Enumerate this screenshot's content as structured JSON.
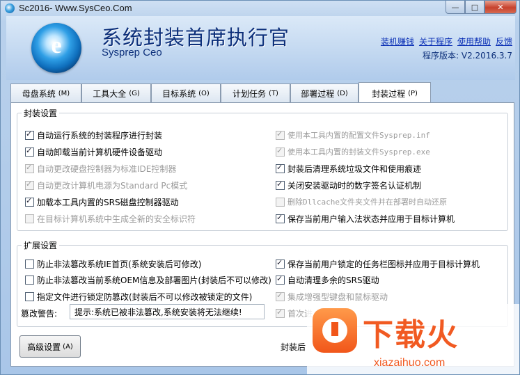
{
  "window": {
    "title": "Sc2016- Www.SysCeo.Com",
    "controls": {
      "minimize": "—",
      "maximize": "□",
      "close": "✕"
    }
  },
  "header": {
    "app_name": "系统封装首席执行官",
    "app_subtitle": "Sysprep  Ceo",
    "links": [
      "装机赚钱",
      "关于程序",
      "使用帮助",
      "反馈"
    ],
    "version": "程序版本: V2.2016.3.7"
  },
  "tabs": [
    {
      "label": "母盘系统",
      "key": "(M)"
    },
    {
      "label": "工具大全",
      "key": "(G)"
    },
    {
      "label": "目标系统",
      "key": "(O)"
    },
    {
      "label": "计划任务",
      "key": "(T)"
    },
    {
      "label": "部署过程",
      "key": "(D)"
    },
    {
      "label": "封装过程",
      "key": "(P)",
      "active": true
    }
  ],
  "seal_settings": {
    "title": "封装设置",
    "left": [
      {
        "label": "自动运行系统的封装程序进行封装",
        "checked": true,
        "enabled": true
      },
      {
        "label": "自动卸载当前计算机硬件设备驱动",
        "checked": true,
        "enabled": true
      },
      {
        "label": "自动更改硬盘控制器为标准IDE控制器",
        "checked": true,
        "enabled": false
      },
      {
        "label": "自动更改计算机电源为Standard Pc模式",
        "checked": true,
        "enabled": false
      },
      {
        "label": "加载本工具内置的SRS磁盘控制器驱动",
        "checked": true,
        "enabled": true
      },
      {
        "label": "在目标计算机系统中生成全新的安全标识符",
        "checked": false,
        "enabled": false
      }
    ],
    "right": [
      {
        "label": "使用本工具内置的配置文件Sysprep.inf",
        "checked": true,
        "enabled": false
      },
      {
        "label": "使用本工具内置的封装文件Sysprep.exe",
        "checked": true,
        "enabled": false
      },
      {
        "label": "封装后清理系统垃圾文件和使用痕迹",
        "checked": true,
        "enabled": true
      },
      {
        "label": "关闭安装驱动时的数字签名认证机制",
        "checked": true,
        "enabled": true
      },
      {
        "label": "删除Dllcache文件夹文件并在部署时自动还原",
        "checked": false,
        "enabled": false
      },
      {
        "label": "保存当前用户输入法状态并应用于目标计算机",
        "checked": true,
        "enabled": true
      }
    ]
  },
  "extended_settings": {
    "title": "扩展设置",
    "left": [
      {
        "label": "防止非法篡改系统IE首页(系统安装后可修改)",
        "checked": false,
        "enabled": true
      },
      {
        "label": "防止非法篡改当前系统OEM信息及部署图片(封装后不可以修改)",
        "checked": false,
        "enabled": true
      },
      {
        "label": "指定文件进行锁定防篡改(封装后不可以修改被锁定的文件)",
        "checked": false,
        "enabled": true
      }
    ],
    "right": [
      {
        "label": "保存当前用户锁定的任务栏图标并应用于目标计算机",
        "checked": true,
        "enabled": true
      },
      {
        "label": "自动清理多余的SRS驱动",
        "checked": true,
        "enabled": true
      },
      {
        "label": "集成增强型键盘和鼠标驱动",
        "checked": true,
        "enabled": false
      },
      {
        "label": "首次进",
        "checked": true,
        "enabled": false
      }
    ],
    "tamper_label": "篡改警告:",
    "tamper_value": "提示:系统已被非法篡改,系统安装将无法继续!"
  },
  "footer": {
    "advanced_button": "高级设置",
    "advanced_key": "(A)",
    "after_seal_label": "封装后"
  },
  "watermark": {
    "title": "下载火",
    "domain": "xiazaihuo.com"
  }
}
